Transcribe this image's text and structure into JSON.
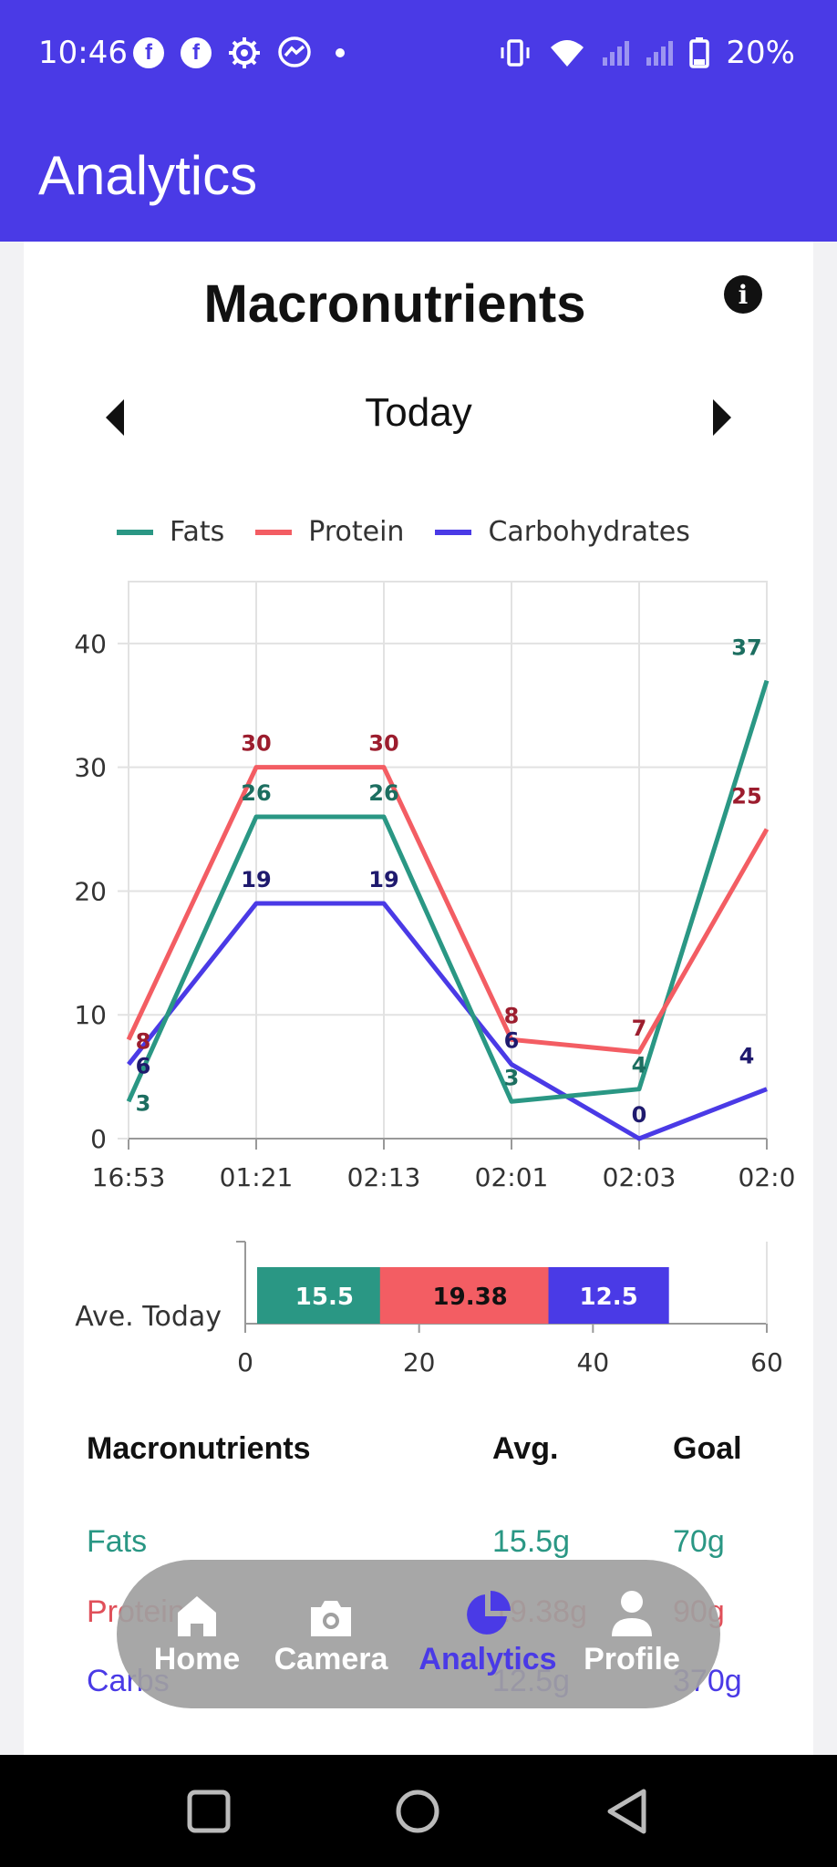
{
  "status_bar": {
    "time": "10:46",
    "battery": "20%",
    "left_icons": [
      "facebook-icon",
      "facebook-icon",
      "settings-gear-icon",
      "messenger-icon",
      "notification-dot"
    ],
    "right_icons": [
      "vibrate-icon",
      "wifi-icon",
      "signal-icon",
      "signal-icon",
      "battery-icon"
    ]
  },
  "app_bar": {
    "title": "Analytics"
  },
  "card": {
    "title": "Macronutrients",
    "period": "Today",
    "info_icon": "info-icon"
  },
  "legend": [
    {
      "label": "Fats",
      "color": "#2a9784"
    },
    {
      "label": "Protein",
      "color": "#f35d63"
    },
    {
      "label": "Carbohydrates",
      "color": "#4a3ae6"
    }
  ],
  "chart_data": [
    {
      "type": "line",
      "x": [
        "16:53",
        "01:21",
        "02:13",
        "02:01",
        "02:03",
        "02:0"
      ],
      "ylim": [
        0,
        45
      ],
      "yticks": [
        0,
        10,
        20,
        30,
        40
      ],
      "grid": true,
      "legend_position": "top",
      "series": [
        {
          "name": "Fats",
          "color": "#2a9784",
          "label_color": "#1c6e60",
          "values": [
            3,
            26,
            26,
            3,
            4,
            37
          ]
        },
        {
          "name": "Protein",
          "color": "#f35d63",
          "label_color": "#9c1d2e",
          "values": [
            8,
            30,
            30,
            8,
            7,
            25
          ]
        },
        {
          "name": "Carbohydrates",
          "color": "#4a3ae6",
          "label_color": "#1f1a6e",
          "values": [
            6,
            19,
            19,
            6,
            0,
            4
          ]
        }
      ]
    },
    {
      "type": "bar",
      "orientation": "horizontal",
      "stacked": true,
      "categories": [
        "Ave. Today"
      ],
      "xlim": [
        0,
        60
      ],
      "xticks": [
        0,
        20,
        40,
        60
      ],
      "series": [
        {
          "name": "Fats",
          "color": "#2a9784",
          "text_color": "#ffffff",
          "values": [
            15.5
          ],
          "label": "15.5"
        },
        {
          "name": "Protein",
          "color": "#f35d63",
          "text_color": "#111111",
          "values": [
            19.38
          ],
          "label": "19.38"
        },
        {
          "name": "Carbohydrates",
          "color": "#4a3ae6",
          "text_color": "#ffffff",
          "values": [
            12.5
          ],
          "label": "12.5"
        }
      ]
    }
  ],
  "table": {
    "headers": {
      "name": "Macronutrients",
      "avg": "Avg.",
      "goal": "Goal"
    },
    "rows": [
      {
        "name": "Fats",
        "avg": "15.5g",
        "goal": "70g",
        "color": "#2a9784"
      },
      {
        "name": "Proteins",
        "avg": "19.38g",
        "goal": "90g",
        "color": "#e0505a"
      },
      {
        "name": "Carbs",
        "avg": "12.5g",
        "goal": "370g",
        "color": "#4a3ae6"
      }
    ]
  },
  "bottom_nav": [
    {
      "label": "Home",
      "icon": "home-icon",
      "active": false
    },
    {
      "label": "Camera",
      "icon": "camera-icon",
      "active": false
    },
    {
      "label": "Analytics",
      "icon": "pie-chart-icon",
      "active": true
    },
    {
      "label": "Profile",
      "icon": "profile-icon",
      "active": false
    }
  ],
  "system_nav": [
    "recents-square-icon",
    "home-circle-icon",
    "back-triangle-icon"
  ]
}
